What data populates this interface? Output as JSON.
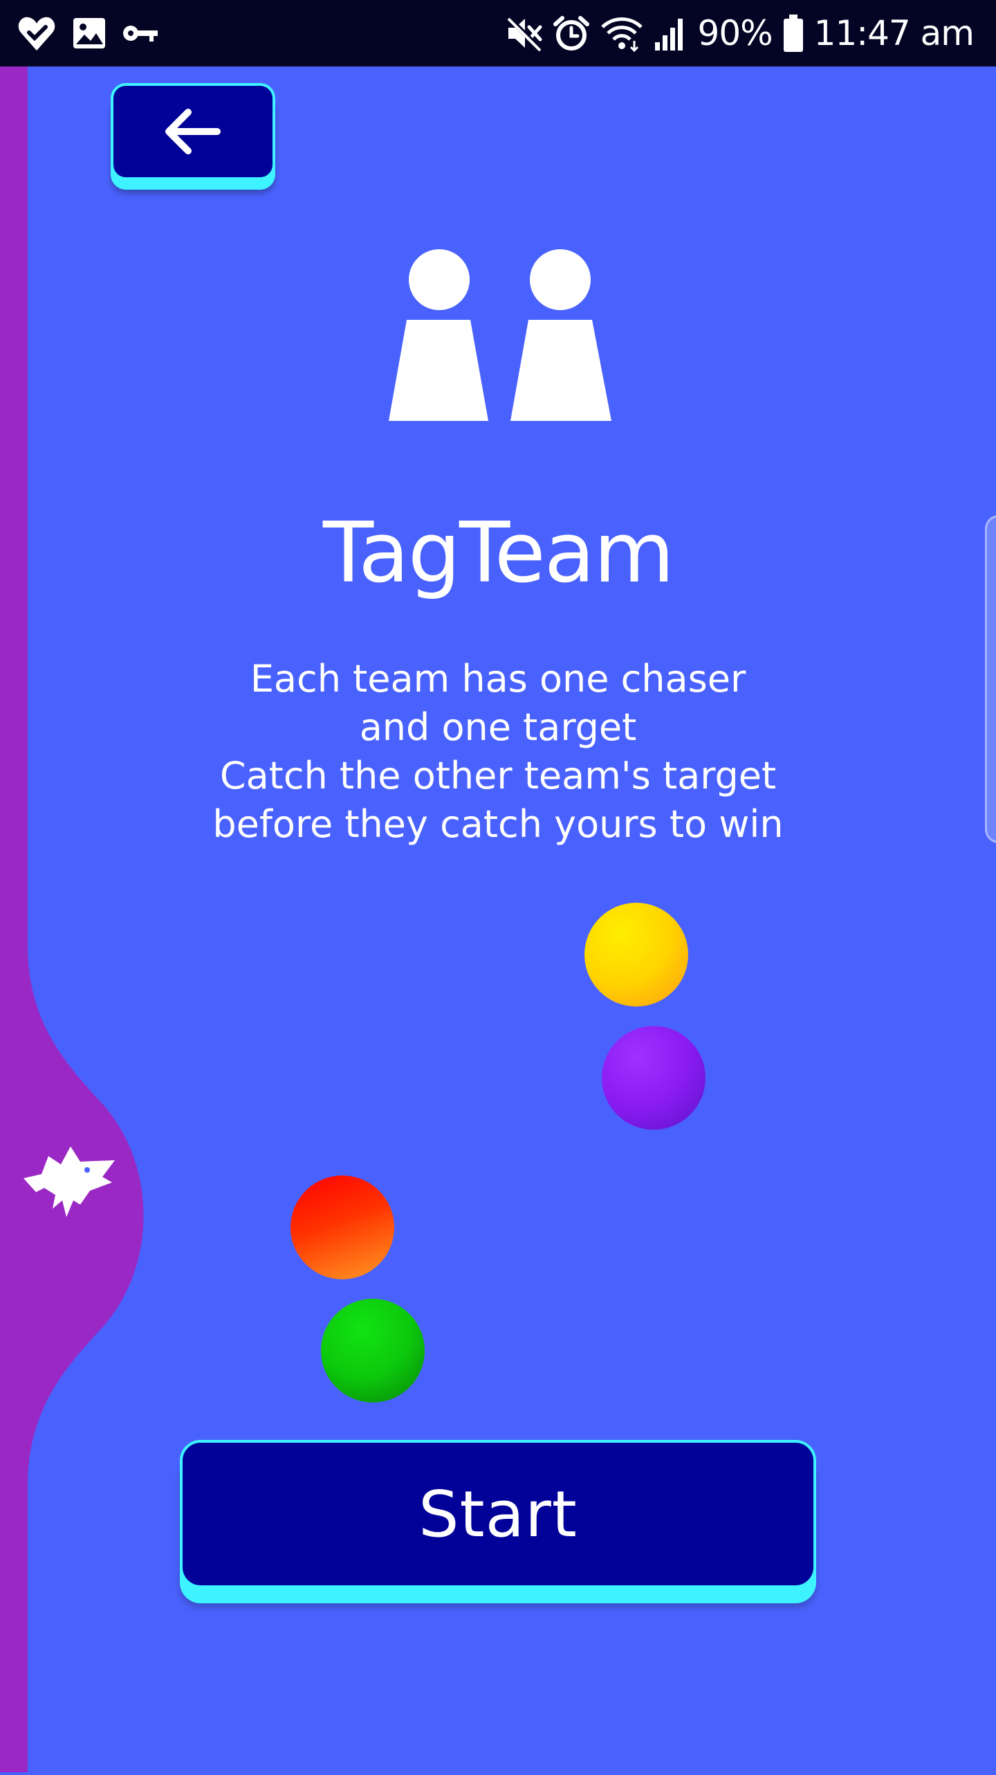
{
  "status_bar": {
    "battery_percent": "90%",
    "time": "11:47 am",
    "left_icons": [
      "heart-check-icon",
      "image-icon",
      "key-icon"
    ],
    "right_icons": [
      "mute-icon",
      "alarm-icon",
      "wifi-icon",
      "signal-icon",
      "battery-icon"
    ]
  },
  "back_button": {
    "icon": "arrow-left-icon"
  },
  "game": {
    "icon": "two-players-icon",
    "title": "TagTeam",
    "description_lines": [
      "Each team has one chaser",
      "and one target",
      "Catch the other team's target",
      "before they catch yours to win"
    ]
  },
  "players": [
    {
      "name": "yellow",
      "color": "#ffd400"
    },
    {
      "name": "purple",
      "color": "#8a1cf2"
    },
    {
      "name": "red",
      "color": "#ff2a00"
    },
    {
      "name": "green",
      "color": "#0cc80c"
    }
  ],
  "start_button": {
    "label": "Start"
  },
  "side_drawer": {
    "icon": "wolf-icon"
  },
  "colors": {
    "background": "#4a62fd",
    "drawer": "#9a28c4",
    "button_fill": "#020299",
    "button_accent": "#3ef2ff",
    "status_bar": "#040424"
  }
}
